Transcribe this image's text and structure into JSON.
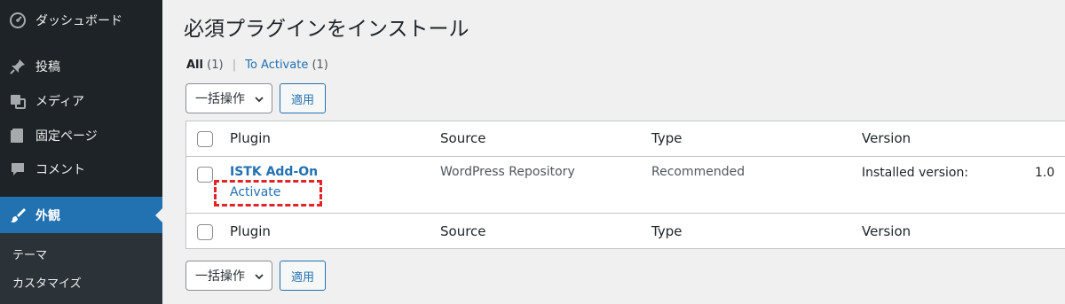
{
  "sidebar": {
    "items": [
      {
        "label": "ダッシュボード",
        "icon": "dashboard-icon"
      },
      {
        "label": "投稿",
        "icon": "pin-icon"
      },
      {
        "label": "メディア",
        "icon": "media-icon"
      },
      {
        "label": "固定ページ",
        "icon": "page-icon"
      },
      {
        "label": "コメント",
        "icon": "comment-icon"
      },
      {
        "label": "外観",
        "icon": "brush-icon",
        "active": true
      }
    ],
    "submenu": [
      {
        "label": "テーマ"
      },
      {
        "label": "カスタマイズ"
      }
    ]
  },
  "page": {
    "title": "必須プラグインをインストール"
  },
  "filters": {
    "all_label": "All",
    "all_count": "(1)",
    "separator": "|",
    "activate_label": "To Activate",
    "activate_count": "(1)"
  },
  "bulk_actions": {
    "top": {
      "select_value": "一括操作",
      "apply_label": "適用"
    },
    "bottom": {
      "select_value": "一括操作",
      "apply_label": "適用"
    }
  },
  "table": {
    "columns": [
      "Plugin",
      "Source",
      "Type",
      "Version"
    ],
    "rows": [
      {
        "plugin": "ISTK Add-On",
        "action": "Activate",
        "source": "WordPress Repository",
        "type": "Recommended",
        "version_label": "Installed version:",
        "version_value": "1.0"
      }
    ]
  },
  "colors": {
    "sidebar_bg": "#1d2327",
    "active_menu_bg": "#2271b1",
    "link": "#2271b1",
    "highlight_dash": "#e0242a",
    "page_bg": "#f0f0f1"
  }
}
